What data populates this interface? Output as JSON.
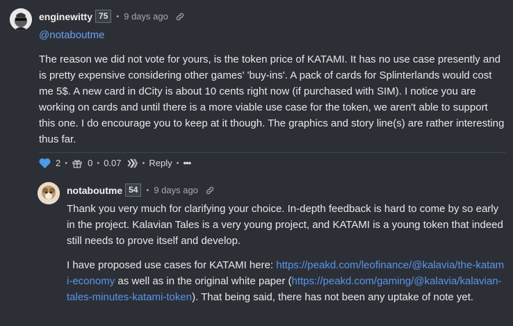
{
  "comments": [
    {
      "username": "enginewitty",
      "reputation": "75",
      "age": "9 days ago",
      "mention": "@notaboutme",
      "paragraphs": [
        "The reason we did not vote for yours, is the token price of KATAMI. It has no use case presently and is pretty expensive considering other games' 'buy-ins'. A pack of cards for Splinterlands would cost me 5$. A new card in dCity is about 10 cents right now (if purchased with SIM). I notice you are working on cards and until there is a more viable use case for the token, we aren't able to support this one. I do encourage you to keep at it though. The graphics and story line(s) are rather interesting thus far."
      ],
      "actions": {
        "likes": "2",
        "gifts": "0",
        "payout": "0.07",
        "reply_label": "Reply",
        "more_label": "•••"
      }
    },
    {
      "username": "notaboutme",
      "reputation": "54",
      "age": "9 days ago",
      "paragraph1": "Thank you very much for clarifying your choice. In-depth feedback is hard to come by so early in the project. Kalavian Tales is a very young project, and KATAMI is a young token that indeed still needs to prove itself and develop.",
      "p2_start": "I have proposed use cases for KATAMI here: ",
      "p2_link1": "https://peakd.com/leofinance/@kalavia/the-katami-economy",
      "p2_mid": " as well as in the original white paper (",
      "p2_link2": "https://peakd.com/gaming/@kalavia/kalavian-tales-minutes-katami-token",
      "p2_end": "). That being said, there has not been any uptake of note yet."
    }
  ],
  "colors": {
    "background": "#2c3036",
    "link": "#5b94ec",
    "heart": "#4a9be8"
  }
}
